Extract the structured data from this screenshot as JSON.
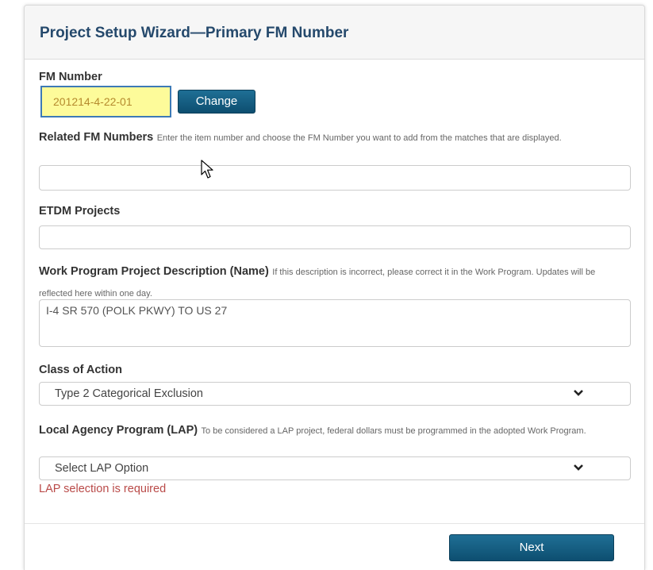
{
  "header": {
    "title": "Project Setup Wizard—Primary FM Number"
  },
  "fm_number": {
    "label": "FM Number",
    "value": "201214-4-22-01",
    "change_label": "Change"
  },
  "related_fm": {
    "label": "Related FM Numbers",
    "help": "Enter the item number and choose the FM Number you want to add from the matches that are displayed.",
    "value": ""
  },
  "etdm": {
    "label": "ETDM Projects",
    "value": ""
  },
  "description": {
    "label": "Work Program Project Description (Name)",
    "help": "If this description is incorrect, please correct it in the Work Program. Updates will be reflected here within one day.",
    "value": "I-4 SR 570 (POLK PKWY) TO US 27"
  },
  "class_of_action": {
    "label": "Class of Action",
    "selected": "Type 2 Categorical Exclusion"
  },
  "lap": {
    "label": "Local Agency Program (LAP)",
    "help": "To be considered a LAP project, federal dollars must be programmed in the adopted Work Program.",
    "selected": "Select LAP Option",
    "error": "LAP selection is required"
  },
  "footer": {
    "next_label": "Next"
  },
  "colors": {
    "title": "#25496c",
    "button": "#0d4e70",
    "error": "#b94a48",
    "highlight": "#fdfb9a"
  }
}
